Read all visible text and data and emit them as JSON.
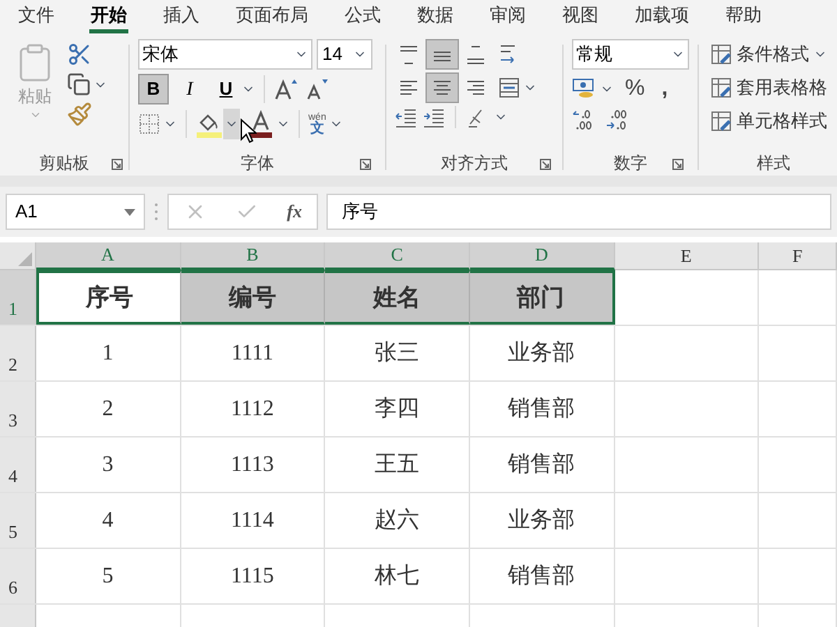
{
  "menu_tabs": [
    {
      "label": "文件",
      "selected": false
    },
    {
      "label": "开始",
      "selected": true
    },
    {
      "label": "插入",
      "selected": false
    },
    {
      "label": "页面布局",
      "selected": false
    },
    {
      "label": "公式",
      "selected": false
    },
    {
      "label": "数据",
      "selected": false
    },
    {
      "label": "审阅",
      "selected": false
    },
    {
      "label": "视图",
      "selected": false
    },
    {
      "label": "加载项",
      "selected": false
    },
    {
      "label": "帮助",
      "selected": false
    }
  ],
  "ribbon": {
    "clipboard": {
      "paste": "粘贴",
      "label": "剪贴板"
    },
    "font": {
      "font_name": "宋体",
      "font_size": "14",
      "bold_label": "B",
      "italic_label": "I",
      "underline_label": "U",
      "bold": true,
      "italic": false,
      "underline": false,
      "fill_hover": true,
      "phonetic_top": "wén",
      "phonetic_char": "文",
      "label": "字体"
    },
    "alignment": {
      "vertical": [
        {
          "kind": "top",
          "selected": false
        },
        {
          "kind": "middle",
          "selected": true
        },
        {
          "kind": "bottom",
          "selected": false
        }
      ],
      "horizontal": [
        {
          "kind": "left",
          "selected": false
        },
        {
          "kind": "center",
          "selected": true
        },
        {
          "kind": "right",
          "selected": false
        }
      ],
      "label": "对齐方式"
    },
    "number": {
      "format": "常规",
      "percent": "%",
      "comma": ",",
      "label": "数字"
    },
    "styles": {
      "items": [
        {
          "label": "条件格式",
          "dropdown": true
        },
        {
          "label": "套用表格格",
          "dropdown": false
        },
        {
          "label": "单元格样式",
          "dropdown": false
        }
      ],
      "label": "样式"
    }
  },
  "formula_bar": {
    "name_box": "A1",
    "fx": "fx",
    "formula": "序号"
  },
  "columns": [
    {
      "label": "A",
      "selected": true
    },
    {
      "label": "B",
      "selected": true
    },
    {
      "label": "C",
      "selected": true
    },
    {
      "label": "D",
      "selected": true
    },
    {
      "label": "E",
      "selected": false
    },
    {
      "label": "F",
      "selected": false
    }
  ],
  "rows": [
    {
      "number": "1",
      "selected": true,
      "cells": [
        "序号",
        "编号",
        "姓名",
        "部门"
      ]
    },
    {
      "number": "2",
      "selected": false,
      "cells": [
        "1",
        "1111",
        "张三",
        "业务部"
      ]
    },
    {
      "number": "3",
      "selected": false,
      "cells": [
        "2",
        "1112",
        "李四",
        "销售部"
      ]
    },
    {
      "number": "4",
      "selected": false,
      "cells": [
        "3",
        "1113",
        "王五",
        "销售部"
      ]
    },
    {
      "number": "5",
      "selected": false,
      "cells": [
        "4",
        "1114",
        "赵六",
        "业务部"
      ]
    },
    {
      "number": "6",
      "selected": false,
      "cells": [
        "5",
        "1115",
        "林七",
        "销售部"
      ]
    }
  ]
}
